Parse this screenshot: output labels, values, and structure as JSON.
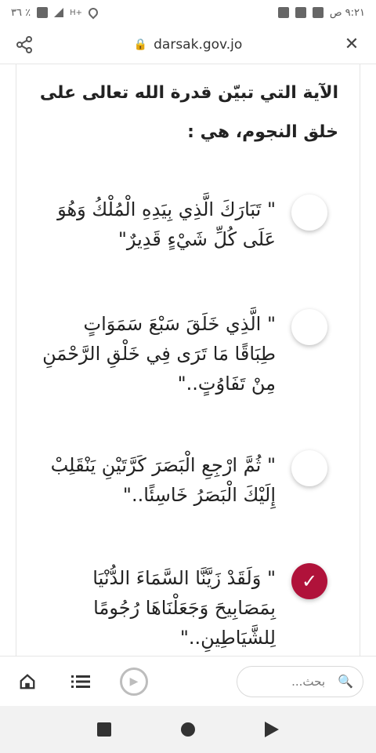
{
  "status": {
    "time": "٩:٢١ ص",
    "battery": "٣٦ ٪"
  },
  "urlbar": {
    "domain": "darsak.gov.jo"
  },
  "question": {
    "text": "الآية التي تبيّن قدرة الله تعالى على خلق النجوم، هي :"
  },
  "options": [
    {
      "text": "\" تَبَارَكَ الَّذِي بِيَدِهِ الْمُلْكُ وَهُوَ عَلَى كُلِّ شَيْءٍ قَدِيرٌ\"",
      "selected": false
    },
    {
      "text": "\" الَّذِي خَلَقَ سَبْعَ سَمَوَاتٍ طِبَاقًا مَا تَرَى فِي خَلْقِ الرَّحْمَنِ مِنْ تَفَاوُتٍ..\"",
      "selected": false
    },
    {
      "text": "\" ثُمَّ ارْجِعِ الْبَصَرَ كَرَّتَيْنِ يَنْقَلِبْ إِلَيْكَ الْبَصَرُ خَاسِئًا..\"",
      "selected": false
    },
    {
      "text": "\" وَلَقَدْ زَيَّنَّا السَّمَاءَ الدُّنْيَا بِمَصَابِيحَ وَجَعَلْنَاهَا رُجُومًا لِلشَّيَاطِينِ..\"",
      "selected": true
    }
  ],
  "toolbar": {
    "search_placeholder": "بحث..."
  },
  "colors": {
    "accent": "#b0123a"
  }
}
